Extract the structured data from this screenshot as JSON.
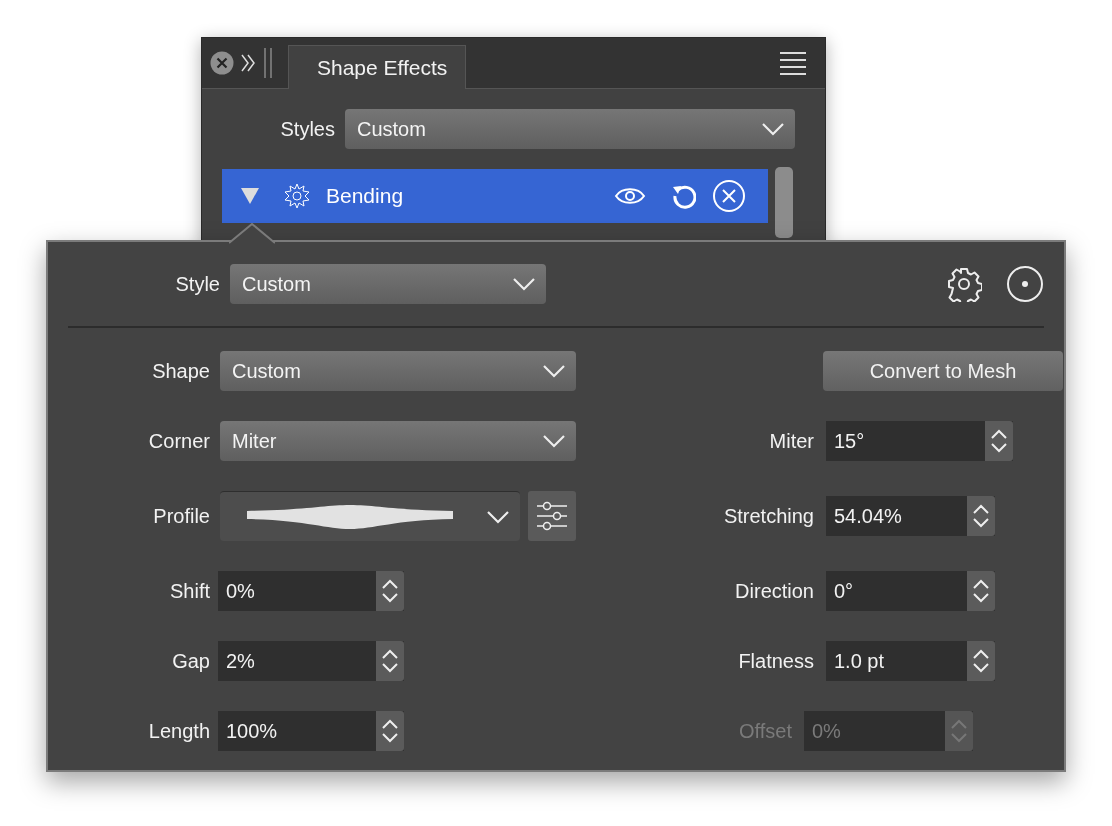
{
  "panel": {
    "tab": {
      "label": "Shape Effects",
      "selected": true
    },
    "styles": {
      "label": "Styles",
      "value": "Custom"
    },
    "effects": [
      {
        "name": "Bending",
        "selected": true,
        "expanded": true
      }
    ]
  },
  "popover": {
    "style": {
      "label": "Style",
      "value": "Custom"
    },
    "left_fields": [
      {
        "kind": "dropdown",
        "label": "Shape",
        "value": "Custom"
      },
      {
        "kind": "dropdown",
        "label": "Corner",
        "value": "Miter"
      },
      {
        "kind": "profile",
        "label": "Profile"
      },
      {
        "kind": "number",
        "label": "Shift",
        "value": "0%",
        "disabled": false
      },
      {
        "kind": "number",
        "label": "Gap",
        "value": "2%",
        "disabled": false
      },
      {
        "kind": "number",
        "label": "Length",
        "value": "100%",
        "disabled": false
      }
    ],
    "right_fields": [
      {
        "kind": "button",
        "label": "Convert to Mesh"
      },
      {
        "kind": "number",
        "label": "Miter",
        "value": "15°",
        "disabled": false
      },
      {
        "kind": "number",
        "label": "Stretching",
        "value": "54.04%",
        "disabled": false
      },
      {
        "kind": "number",
        "label": "Direction",
        "value": "0°",
        "disabled": false
      },
      {
        "kind": "number",
        "label": "Flatness",
        "value": "1.0 pt",
        "disabled": false
      },
      {
        "kind": "number",
        "label": "Offset",
        "value": "0%",
        "disabled": true
      }
    ]
  }
}
